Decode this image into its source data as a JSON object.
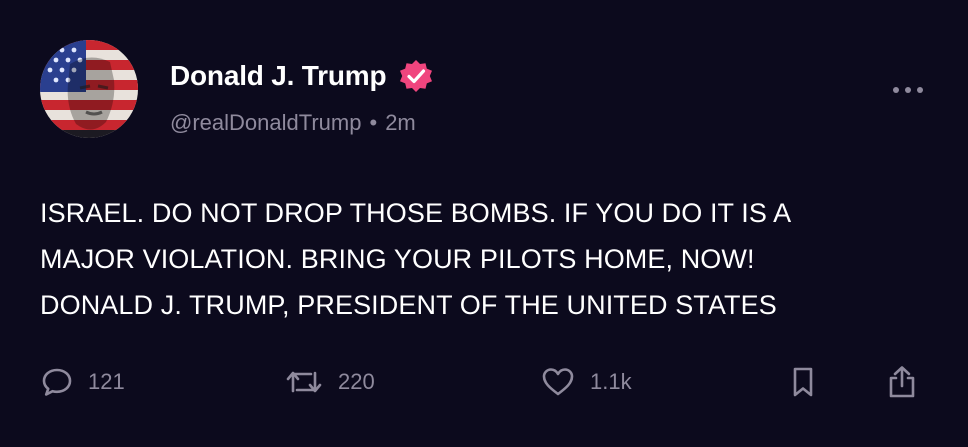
{
  "post": {
    "author": {
      "display_name": "Donald J. Trump",
      "handle": "@realDonaldTrump",
      "separator": "•",
      "time_ago": "2m",
      "verified_badge_color": "#f0457e"
    },
    "more_icon": "ellipsis-icon",
    "text_lines": [
      "ISRAEL. DO NOT DROP THOSE BOMBS. IF YOU DO IT IS A",
      "MAJOR VIOLATION. BRING YOUR PILOTS HOME, NOW!",
      "DONALD J. TRUMP, PRESIDENT OF THE UNITED STATES"
    ],
    "actions": {
      "reply": {
        "icon": "comment-bubble-icon",
        "count": "121"
      },
      "repost": {
        "icon": "repost-arrows-icon",
        "count": "220"
      },
      "like": {
        "icon": "heart-icon",
        "count": "1.1k"
      },
      "bookmark": {
        "icon": "bookmark-icon"
      },
      "share": {
        "icon": "share-upload-icon"
      }
    }
  },
  "colors": {
    "background": "#0c0a1d",
    "text_primary": "#ffffff",
    "text_secondary": "#8f8a9d",
    "accent_badge": "#f0457e"
  }
}
